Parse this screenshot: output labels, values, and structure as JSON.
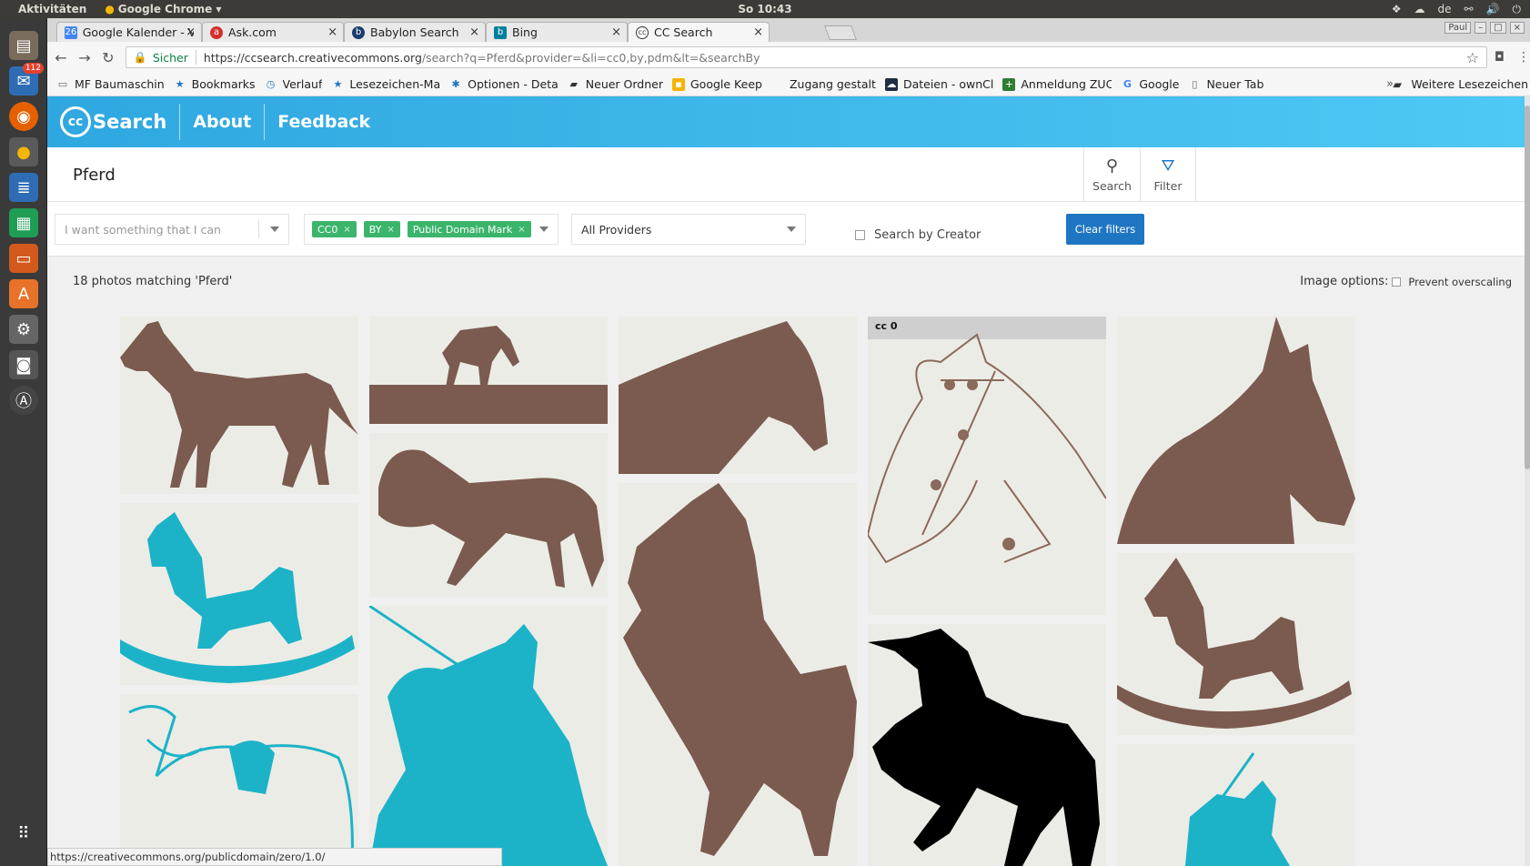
{
  "system": {
    "activities": "Aktivitäten",
    "app_name": "Google Chrome",
    "clock": "So 10:43",
    "language": "de",
    "mail_badge": "112",
    "user": "Paul"
  },
  "tabs": [
    {
      "label": "Google Kalender - V",
      "favicon": "calendar-icon"
    },
    {
      "label": "Ask.com",
      "favicon": "ask-icon"
    },
    {
      "label": "Babylon Search",
      "favicon": "babylon-icon"
    },
    {
      "label": "Bing",
      "favicon": "bing-icon"
    },
    {
      "label": "CC Search",
      "favicon": "cc-icon",
      "active": true
    }
  ],
  "address": {
    "secure_label": "Sicher",
    "url_host": "https://ccsearch.creativecommons.org",
    "url_rest": "/search?q=Pferd&provider=&li=cc0,by,pdm&lt=&searchBy"
  },
  "bookmarks": [
    {
      "label": "MF Baumaschin",
      "icon": "page-icon"
    },
    {
      "label": "Bookmarks",
      "icon": "star-icon"
    },
    {
      "label": "Verlauf",
      "icon": "history-icon"
    },
    {
      "label": "Lesezeichen-Ma",
      "icon": "star-icon"
    },
    {
      "label": "Optionen - Deta",
      "icon": "gear-icon"
    },
    {
      "label": "Neuer Ordner",
      "icon": "folder-icon"
    },
    {
      "label": "Google Keep",
      "icon": "keep-icon"
    },
    {
      "label": "Zugang gestalt",
      "icon": "blank-icon"
    },
    {
      "label": "Dateien - ownCl",
      "icon": "owncloud-icon"
    },
    {
      "label": "Anmeldung ZUC",
      "icon": "plus-icon"
    },
    {
      "label": "Google",
      "icon": "google-icon"
    },
    {
      "label": "Neuer Tab",
      "icon": "page-icon"
    }
  ],
  "bookmarks_more": "»",
  "bookmarks_other": "Weitere Lesezeichen",
  "site": {
    "logo_text": "Search",
    "logo_cc": "cc",
    "nav": {
      "about": "About",
      "feedback": "Feedback"
    }
  },
  "search": {
    "query": "Pferd",
    "search_label": "Search",
    "filter_label": "Filter"
  },
  "filters": {
    "use_placeholder": "I want something that I can",
    "license_chips": [
      "CC0",
      "BY",
      "Public Domain Mark"
    ],
    "providers_label": "All Providers",
    "creator_label": "Search by Creator",
    "clear_label": "Clear filters"
  },
  "results": {
    "count_text": "18 photos matching 'Pferd'",
    "image_options_label": "Image options:",
    "prevent_overscaling_label": "Prevent overscaling"
  },
  "images": [
    {
      "name": "brown-standing-horse",
      "color": "#7b5b4f"
    },
    {
      "name": "brown-grazing-horse",
      "color": "#7b5b4f"
    },
    {
      "name": "brown-horse-head",
      "color": "#7b5b4f"
    },
    {
      "name": "horse-bridle-drawing",
      "color": "#8a6a5a",
      "badge": "cc 0"
    },
    {
      "name": "brown-horse-bust",
      "color": "#7b5b4f"
    },
    {
      "name": "cyan-rocking-horse",
      "color": "#1cb3c8"
    },
    {
      "name": "brown-wild-horse",
      "color": "#7b5b4f"
    },
    {
      "name": "brown-rearing-horse",
      "color": "#7b5b4f"
    },
    {
      "name": "black-unicorn",
      "color": "#000000"
    },
    {
      "name": "brown-rocking-horse",
      "color": "#7b5b4f"
    },
    {
      "name": "cyan-saddle-horse",
      "color": "#1cb3c8"
    },
    {
      "name": "cyan-knight-horse",
      "color": "#1cb3c8"
    },
    {
      "name": "cyan-small-knight",
      "color": "#1cb3c8"
    }
  ],
  "status_url": "https://creativecommons.org/publicdomain/zero/1.0/"
}
